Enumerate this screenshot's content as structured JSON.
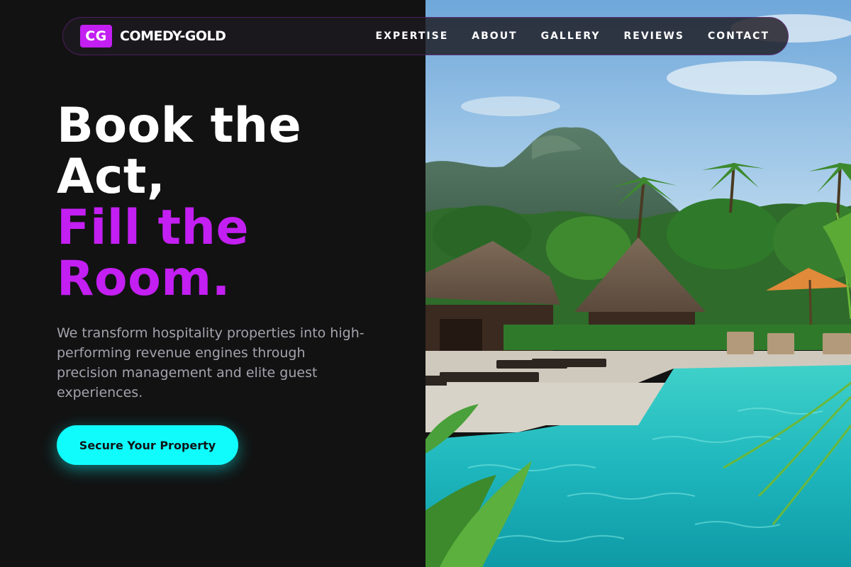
{
  "brand": {
    "initials": "CG",
    "name": "COMEDY-GOLD"
  },
  "nav": {
    "items": [
      {
        "label": "EXPERTISE"
      },
      {
        "label": "ABOUT"
      },
      {
        "label": "GALLERY"
      },
      {
        "label": "REVIEWS"
      },
      {
        "label": "CONTACT"
      }
    ]
  },
  "hero": {
    "title_lines": [
      "Book the",
      "Act,"
    ],
    "highlight_lines": [
      "Fill the",
      "Room."
    ],
    "description": "We transform hospitality properties into high-performing revenue engines through precision management and elite guest experiences.",
    "cta_label": "Secure Your Property"
  },
  "image": {
    "subject": "tropical resort with swimming pool, thatched bungalows, palm trees and a limestone mountain"
  },
  "colors": {
    "background": "#121212",
    "accent_purple": "#c31ff2",
    "accent_cyan": "#10fcfc",
    "text_muted": "#a3a3ad"
  }
}
